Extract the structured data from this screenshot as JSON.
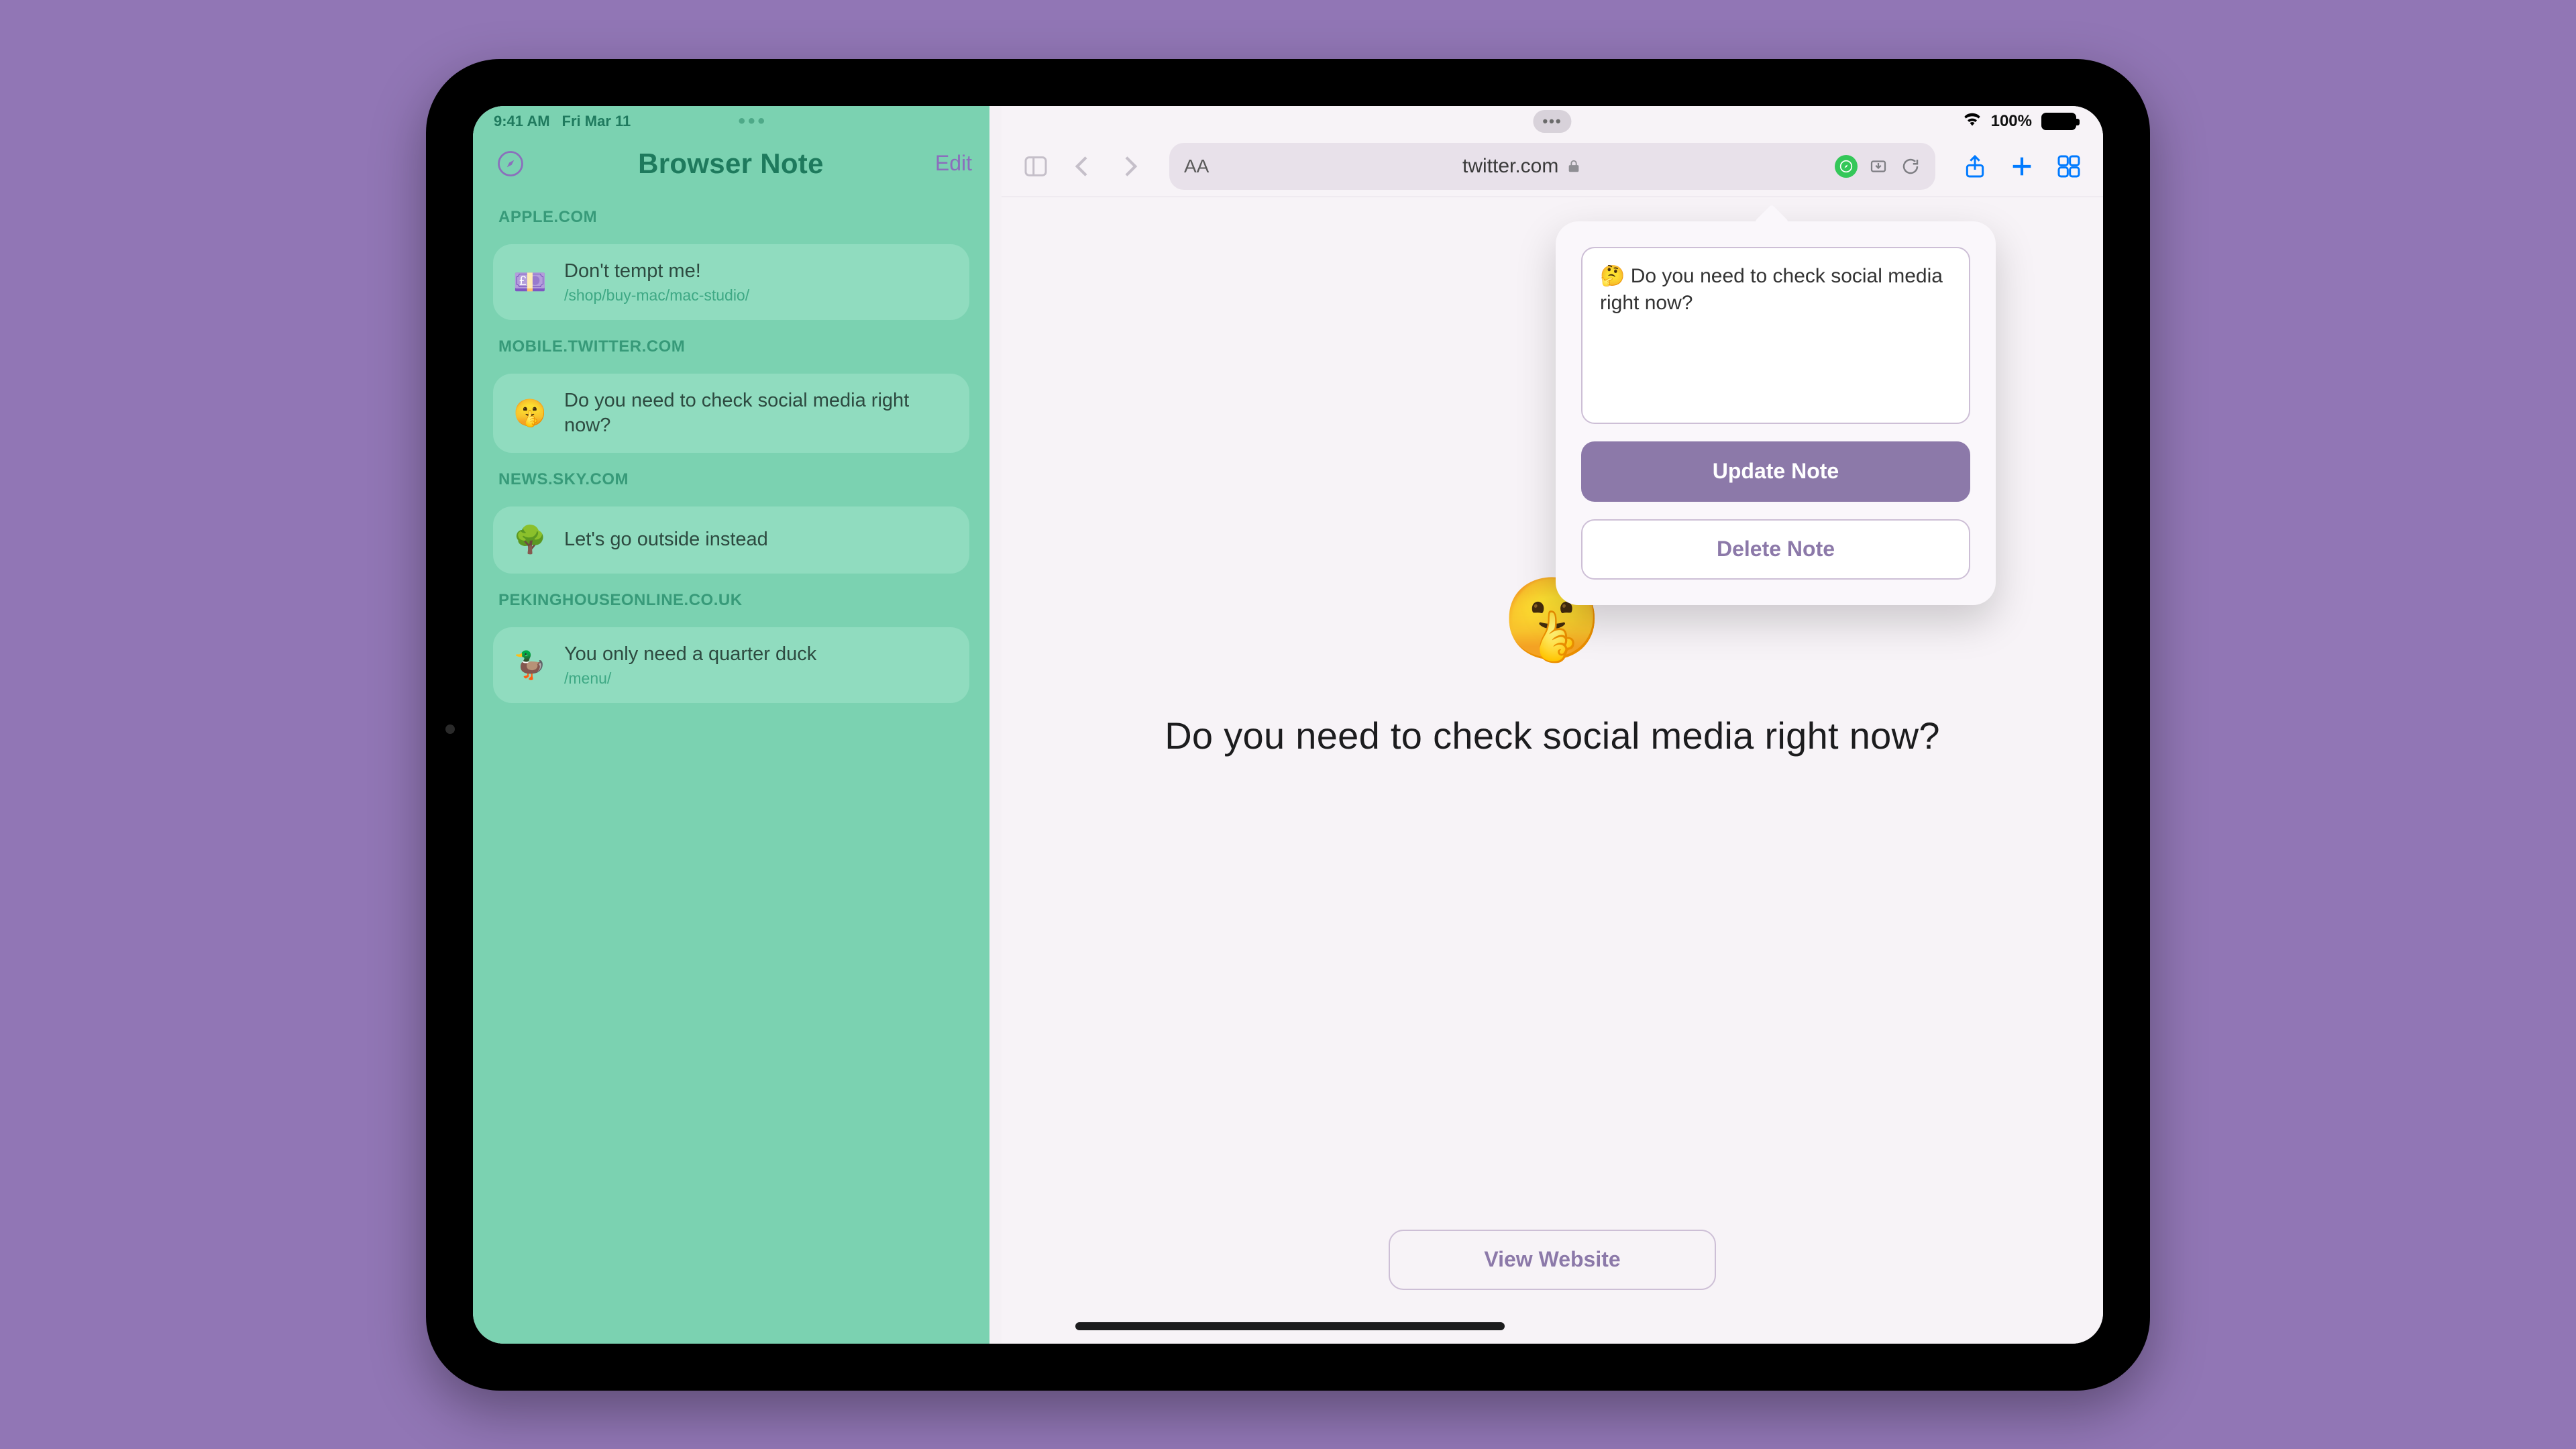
{
  "status": {
    "time": "9:41 AM",
    "date": "Fri Mar 11",
    "battery": "100%"
  },
  "sidebar": {
    "title": "Browser Note",
    "edit_label": "Edit",
    "sections": [
      {
        "domain": "APPLE.COM",
        "emoji": "💷",
        "title": "Don't tempt me!",
        "subtitle": "/shop/buy-mac/mac-studio/"
      },
      {
        "domain": "MOBILE.TWITTER.COM",
        "emoji": "🤫",
        "title": "Do you need to check social media right now?",
        "subtitle": ""
      },
      {
        "domain": "NEWS.SKY.COM",
        "emoji": "🌳",
        "title": "Let's go outside instead",
        "subtitle": ""
      },
      {
        "domain": "PEKINGHOUSEONLINE.CO.UK",
        "emoji": "🦆",
        "title": "You only need a quarter duck",
        "subtitle": "/menu/"
      }
    ]
  },
  "safari": {
    "url_host": "twitter.com"
  },
  "popover": {
    "note_text": "🤔 Do you need to check social media right now?",
    "update_label": "Update Note",
    "delete_label": "Delete Note"
  },
  "hero": {
    "emoji": "🤫",
    "message": "Do you need to check social media right now?",
    "view_label": "View Website"
  }
}
